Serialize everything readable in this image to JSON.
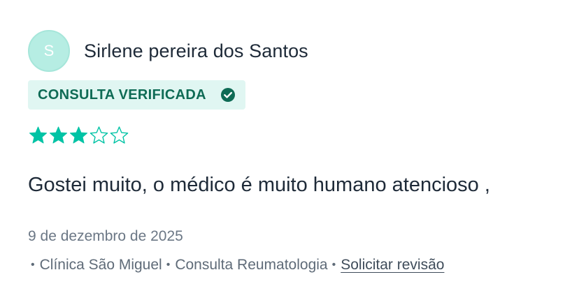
{
  "review": {
    "avatar_initial": "S",
    "author_name": "Sirlene pereira dos Santos",
    "badge_label": "CONSULTA VERIFICADA",
    "rating": 3,
    "rating_max": 5,
    "comment": "Gostei muito, o médico é muito humano atencioso ,",
    "date": "9 de dezembro de 2025",
    "meta": {
      "clinic": "Clínica São Miguel",
      "consultation": "Consulta Reumatologia",
      "request_review_label": "Solicitar revisão"
    }
  },
  "colors": {
    "accent": "#00c3a5",
    "badge_bg": "#e0f6f2",
    "badge_text": "#0e6b55",
    "avatar_bg": "#b6ede3"
  },
  "icons": {
    "verified": "check-circle-icon",
    "star_filled": "star-filled-icon",
    "star_empty": "star-outline-icon"
  }
}
